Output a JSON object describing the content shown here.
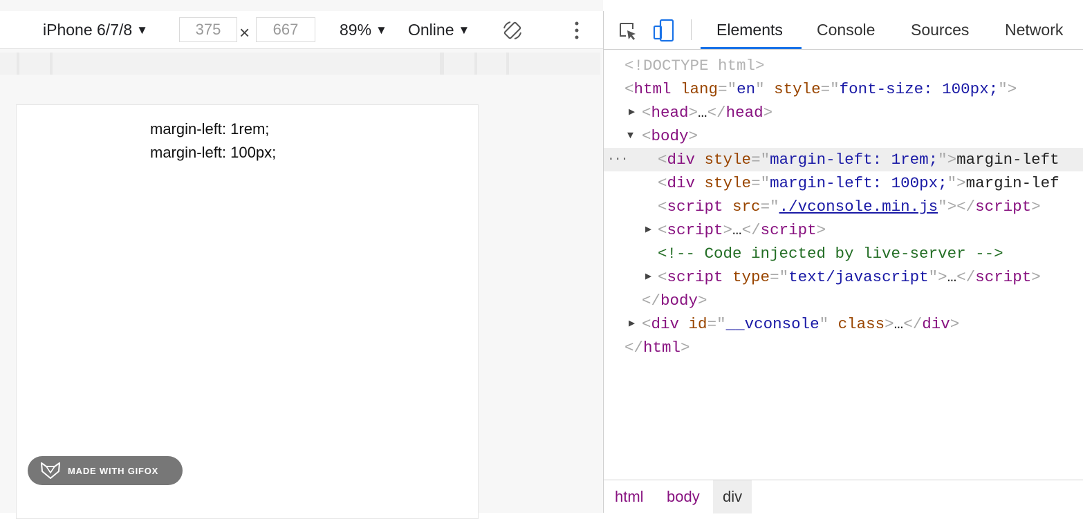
{
  "device_toolbar": {
    "device": "iPhone 6/7/8",
    "width": "375",
    "height": "667",
    "times": "×",
    "zoom": "89%",
    "throttle": "Online",
    "dropdown_arrow": "▼"
  },
  "viewport": {
    "lines": [
      "margin-left: 1rem;",
      "margin-left: 100px;"
    ],
    "badge": "MADE WITH GIFOX"
  },
  "devtools": {
    "tabs": [
      "Elements",
      "Console",
      "Sources",
      "Network"
    ],
    "active_tab": "Elements",
    "accent": "#1a73e8",
    "breadcrumb": [
      "html",
      "body",
      "div"
    ],
    "selected_crumb": "div",
    "dom": {
      "doctype": "<!DOCTYPE html>",
      "html_tag": "html",
      "html_lang_attr": "lang",
      "html_lang_val": "en",
      "html_style_attr": "style",
      "html_style_val": "font-size: 100px;",
      "head_tag": "head",
      "body_tag": "body",
      "div1_style": "margin-left: 1rem;",
      "div1_text": "margin-left",
      "div2_style": "margin-left: 100px;",
      "div2_text": "margin-lef",
      "script_src_attr": "src",
      "script_src_val": "./vconsole.min.js",
      "script_tag": "script",
      "comment": "<!-- Code injected by live-server -->",
      "script_type_attr": "type",
      "script_type_val": "text/javascript",
      "div_tag": "div",
      "vconsole_id_attr": "id",
      "vconsole_id_val": "__vconsole",
      "vconsole_class_attr": "class",
      "ellipsis": "…",
      "selected_dots": "···"
    }
  }
}
